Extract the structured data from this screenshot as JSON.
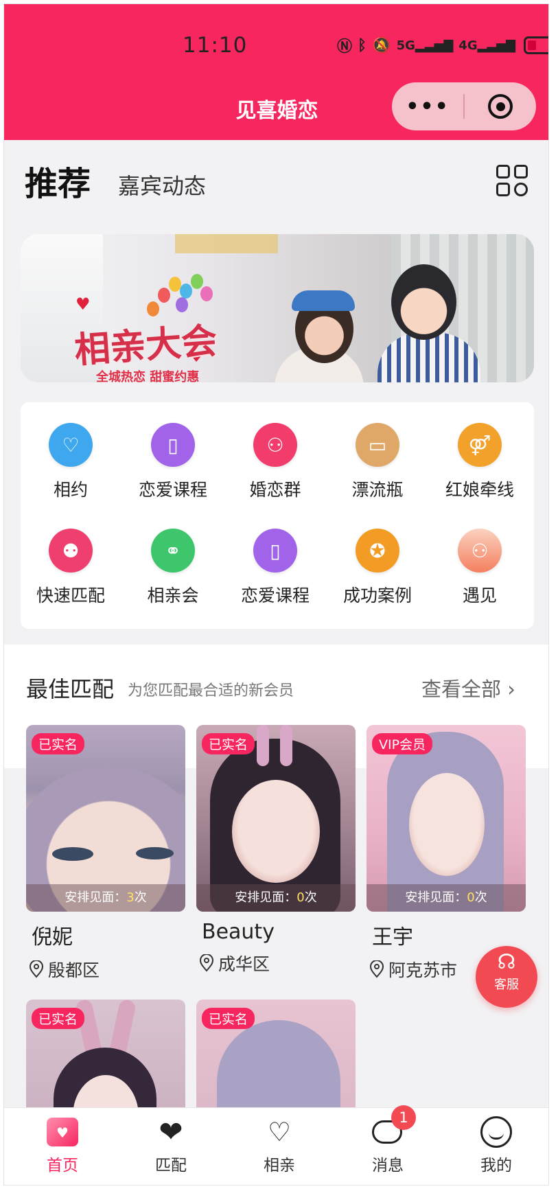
{
  "status_bar": {
    "time": "11:10",
    "icons": [
      "nfc-icon",
      "bluetooth-icon",
      "mute-icon",
      "5g-signal-icon",
      "4g-signal-icon",
      "battery-icon"
    ]
  },
  "header": {
    "title": "见喜婚恋",
    "capsule_more": "•••"
  },
  "tabs": {
    "active": "推荐",
    "other": "嘉宾动态"
  },
  "banner": {
    "title": "相亲大会",
    "subtitle": "全城热恋 甜蜜约惠"
  },
  "shortcuts": [
    {
      "label": "相约",
      "icon": "heart-chat-icon",
      "color": "#3fa7ee"
    },
    {
      "label": "恋爱课程",
      "icon": "book-icon",
      "color": "#a063e9"
    },
    {
      "label": "婚恋群",
      "icon": "group-icon",
      "color": "#f23c6c"
    },
    {
      "label": "漂流瓶",
      "icon": "bottle-icon",
      "color": "#e0a868"
    },
    {
      "label": "红娘牵线",
      "icon": "gender-icon",
      "color": "#f2a12a"
    },
    {
      "label": "快速匹配",
      "icon": "match-icon",
      "color": "#ee3f6f"
    },
    {
      "label": "相亲会",
      "icon": "rings-icon",
      "color": "#3dc66b"
    },
    {
      "label": "恋爱课程",
      "icon": "book-icon",
      "color": "#a063e9"
    },
    {
      "label": "成功案例",
      "icon": "medal-icon",
      "color": "#f29b25"
    },
    {
      "label": "遇见",
      "icon": "people-icon",
      "color": "#f6a68e"
    }
  ],
  "best_match": {
    "title": "最佳匹配",
    "subtitle": "为您匹配最合适的新会员",
    "see_all": "查看全部",
    "meet_prefix": "安排见面：",
    "meet_suffix": "次",
    "members": [
      {
        "badge": "已实名",
        "meet_count": "3",
        "name": "倪妮",
        "location": "殷都区"
      },
      {
        "badge": "已实名",
        "meet_count": "0",
        "name": "Beauty",
        "location": "成华区"
      },
      {
        "badge": "VIP会员",
        "meet_count": "0",
        "name": "王宇",
        "location": "阿克苏市"
      },
      {
        "badge": "已实名"
      },
      {
        "badge": "已实名"
      }
    ]
  },
  "customer_service": {
    "label": "客服"
  },
  "bottom_nav": [
    {
      "label": "首页",
      "active": true
    },
    {
      "label": "匹配"
    },
    {
      "label": "相亲"
    },
    {
      "label": "消息",
      "badge": "1"
    },
    {
      "label": "我的"
    }
  ],
  "colors": {
    "brand": "#f7265f",
    "badge": "#f24a52",
    "highlight": "#ffe066"
  }
}
